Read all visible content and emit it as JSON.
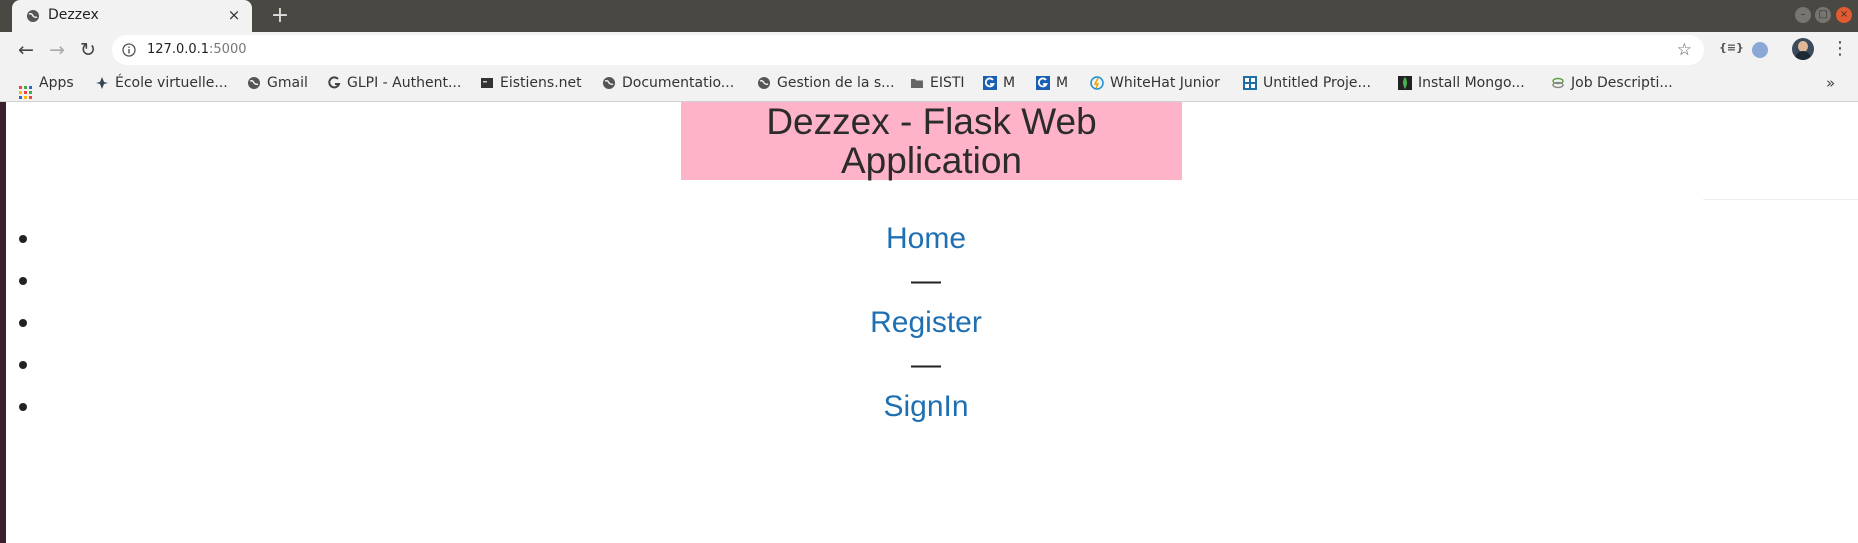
{
  "tab": {
    "title": "Dezzex",
    "close": "×",
    "new": "+"
  },
  "toolbar": {
    "url_host": "127.0.0.1",
    "url_port": ":5000",
    "back": "←",
    "forward": "→",
    "reload": "↻",
    "star": "☆",
    "ext1": "{≡}",
    "menu": "⋮"
  },
  "bookmarks": {
    "items": [
      {
        "label": "Apps"
      },
      {
        "label": "École virtuelle..."
      },
      {
        "label": "Gmail"
      },
      {
        "label": "GLPI - Authent..."
      },
      {
        "label": "Eistiens.net"
      },
      {
        "label": "Documentatio..."
      },
      {
        "label": "Gestion de la s..."
      },
      {
        "label": "EISTI"
      },
      {
        "label": "M"
      },
      {
        "label": "M"
      },
      {
        "label": "WhiteHat Junior"
      },
      {
        "label": "Untitled Proje..."
      },
      {
        "label": "Install Mongo..."
      },
      {
        "label": "Job Descripti..."
      }
    ],
    "more": "»"
  },
  "page": {
    "header_line1": "Dezzex - Flask Web",
    "header_line2": "Application",
    "nav": [
      {
        "label": "Home",
        "type": "link"
      },
      {
        "label": "—",
        "type": "separator"
      },
      {
        "label": "Register",
        "type": "link"
      },
      {
        "label": "—",
        "type": "separator"
      },
      {
        "label": "SignIn",
        "type": "link"
      }
    ]
  },
  "colors": {
    "header_bg": "#ffb3c9",
    "link": "#1f70b3"
  }
}
